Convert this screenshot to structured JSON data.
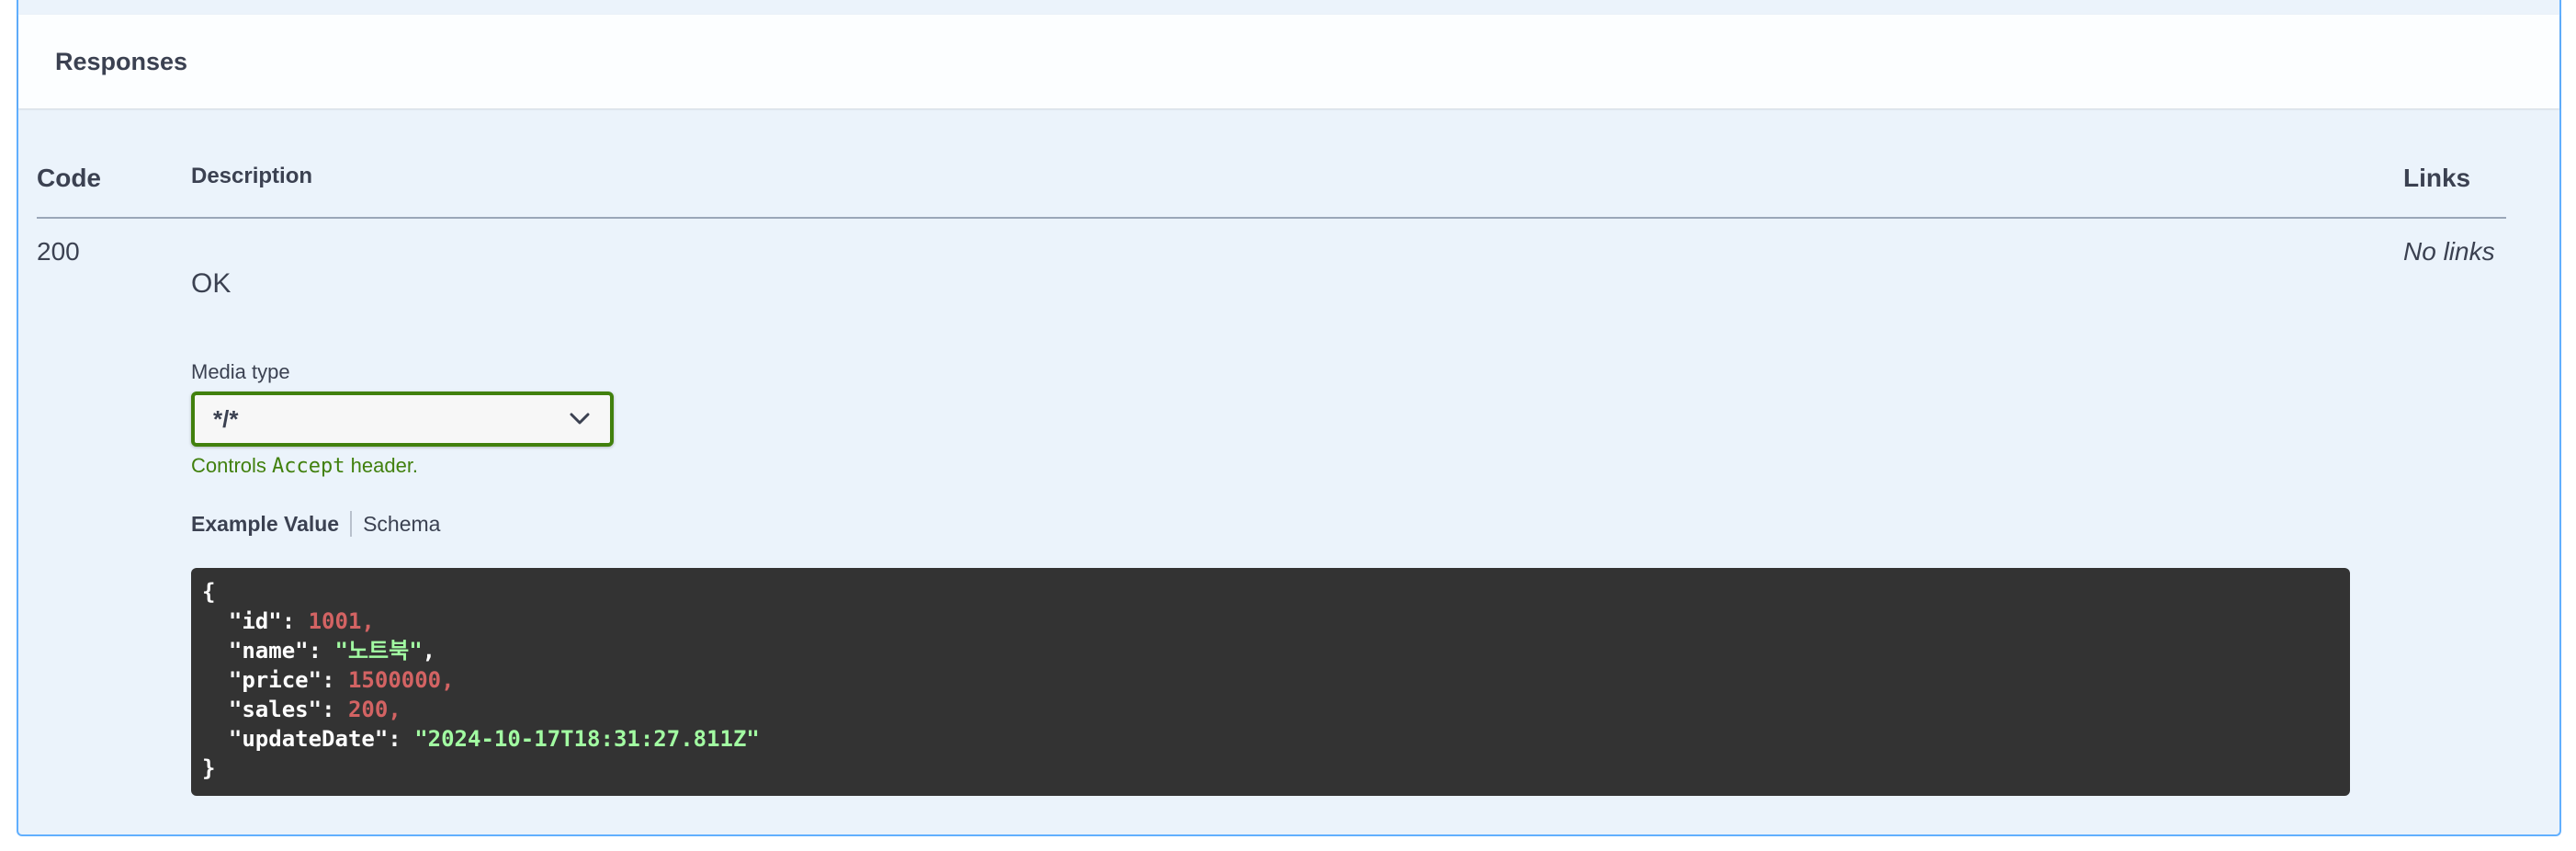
{
  "responses": {
    "title": "Responses",
    "columns": {
      "code": "Code",
      "description": "Description",
      "links": "Links"
    },
    "rows": [
      {
        "code": "200",
        "description": "OK",
        "links": "No links",
        "media_type": {
          "label": "Media type",
          "selected": "*/*",
          "note_prefix": "Controls ",
          "note_code": "Accept",
          "note_suffix": " header."
        },
        "tabs": [
          {
            "label": "Example Value",
            "active": true
          },
          {
            "label": "Schema",
            "active": false
          }
        ],
        "example": {
          "open": "{",
          "close": "}",
          "fields": [
            {
              "key": "\"id\"",
              "sep": ": ",
              "value": "1001",
              "type": "number",
              "trail": ","
            },
            {
              "key": "\"name\"",
              "sep": ": ",
              "value": "\"노트북\"",
              "type": "string",
              "trail": ","
            },
            {
              "key": "\"price\"",
              "sep": ": ",
              "value": "1500000",
              "type": "number",
              "trail": ","
            },
            {
              "key": "\"sales\"",
              "sep": ": ",
              "value": "200",
              "type": "number",
              "trail": ","
            },
            {
              "key": "\"updateDate\"",
              "sep": ": ",
              "value": "\"2024-10-17T18:31:27.811Z\"",
              "type": "string",
              "trail": ""
            }
          ]
        }
      }
    ]
  },
  "colors": {
    "border": "#61affe",
    "background": "#ebf3fb",
    "select_border": "#41800d",
    "code_bg": "#333333",
    "json_number": "#d36363",
    "json_string": "#a2fca2"
  }
}
